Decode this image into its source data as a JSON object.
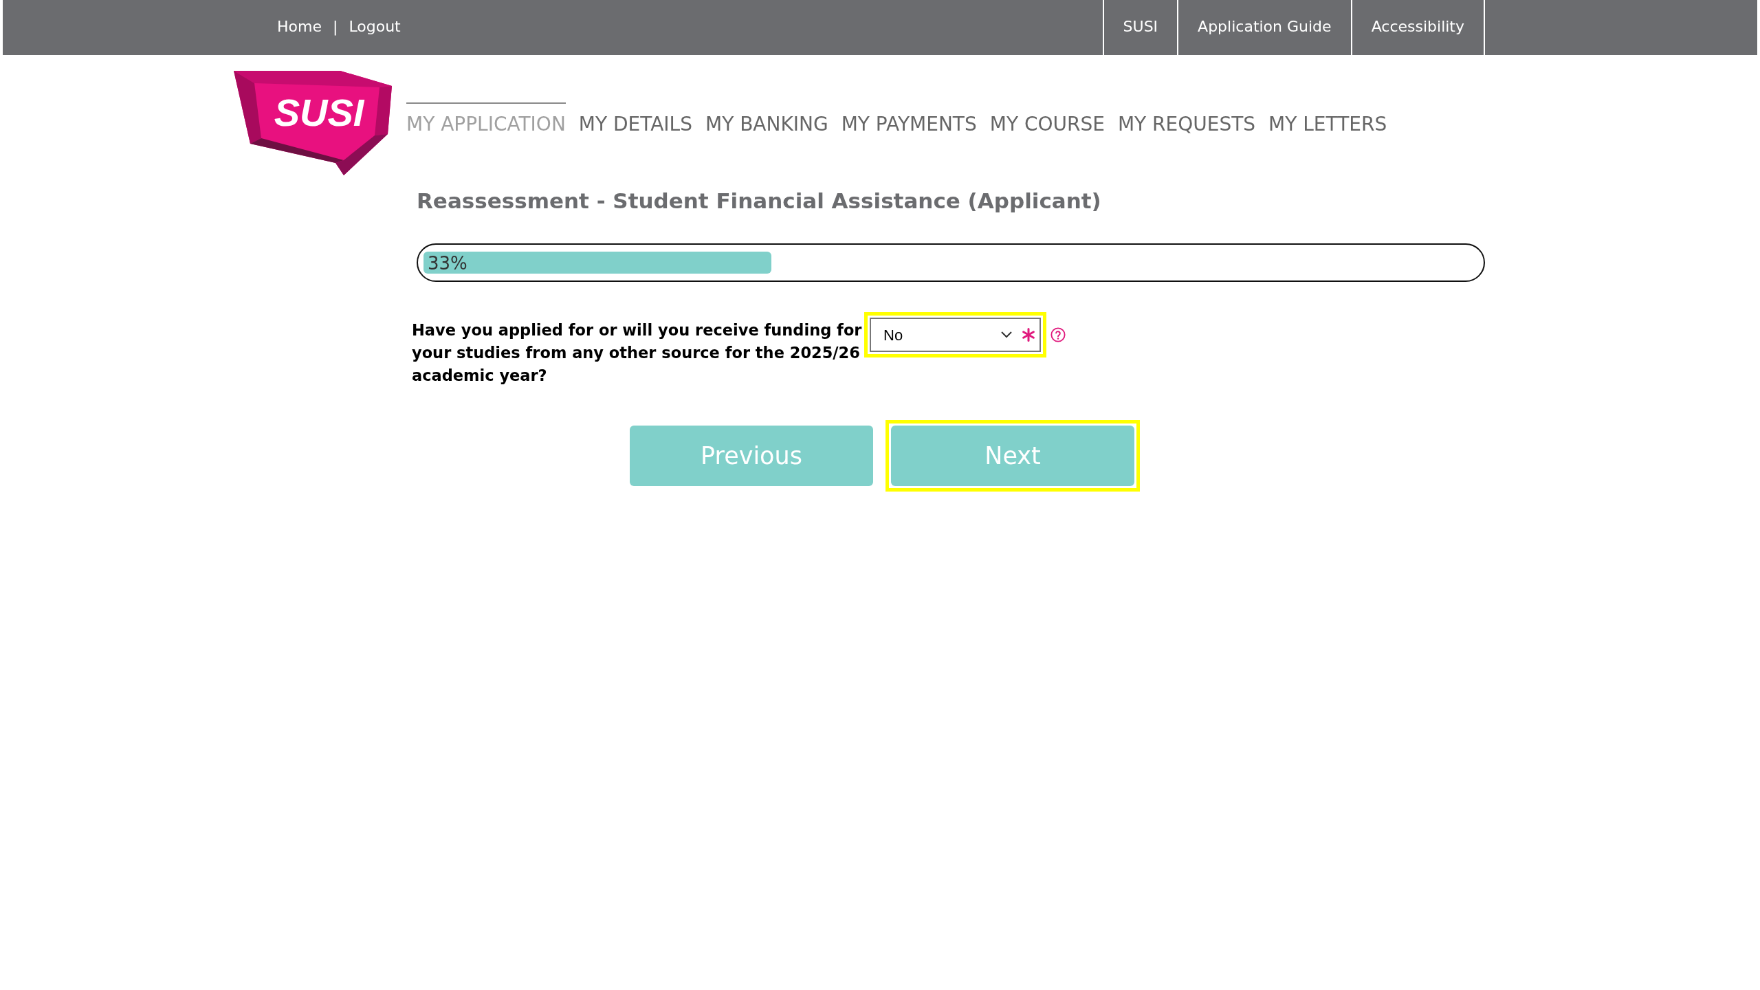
{
  "top_bar": {
    "links": [
      {
        "label": "Home"
      },
      {
        "label": "Logout"
      }
    ],
    "separator": "|",
    "tabs": [
      {
        "label": "SUSI"
      },
      {
        "label": "Application Guide"
      },
      {
        "label": "Accessibility"
      }
    ]
  },
  "logo": {
    "text": "SUSI"
  },
  "nav": [
    {
      "label": "MY APPLICATION",
      "selected": true
    },
    {
      "label": "MY DETAILS",
      "selected": false
    },
    {
      "label": "MY BANKING",
      "selected": false
    },
    {
      "label": "MY PAYMENTS",
      "selected": false
    },
    {
      "label": "MY COURSE",
      "selected": false
    },
    {
      "label": "MY REQUESTS",
      "selected": false
    },
    {
      "label": "MY LETTERS",
      "selected": false
    }
  ],
  "page_title": "Reassessment - Student Financial Assistance (Applicant)",
  "progress": {
    "level": 0.33,
    "label": "33%"
  },
  "questions": [
    {
      "label": "Have you applied for or will you receive funding for your studies from any other source for the 2025/26 academic year?",
      "value": "No",
      "required": true,
      "focused": true
    }
  ],
  "buttons": [
    {
      "label": "Previous",
      "focused": false
    },
    {
      "label": "Next",
      "focused": true
    }
  ]
}
